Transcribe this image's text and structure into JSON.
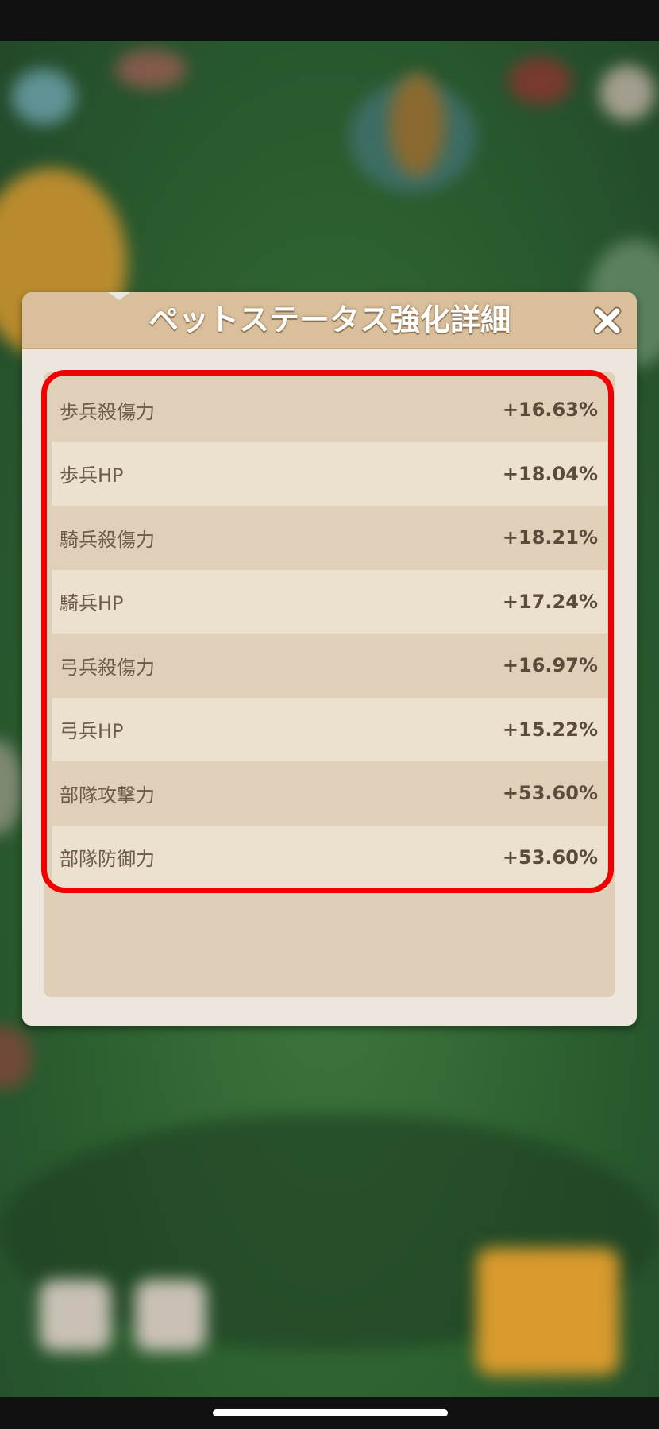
{
  "dialog": {
    "title": "ペットステータス強化詳細",
    "close_icon": "close-icon"
  },
  "stats": [
    {
      "label": "歩兵殺傷力",
      "value": "+16.63%"
    },
    {
      "label": "歩兵HP",
      "value": "+18.04%"
    },
    {
      "label": "騎兵殺傷力",
      "value": "+18.21%"
    },
    {
      "label": "騎兵HP",
      "value": "+17.24%"
    },
    {
      "label": "弓兵殺傷力",
      "value": "+16.97%"
    },
    {
      "label": "弓兵HP",
      "value": "+15.22%"
    },
    {
      "label": "部隊攻撃力",
      "value": "+53.60%"
    },
    {
      "label": "部隊防御力",
      "value": "+53.60%"
    }
  ],
  "colors": {
    "highlight": "#f00000",
    "header": "#d9bf9b",
    "panel": "#dfcfb9"
  }
}
